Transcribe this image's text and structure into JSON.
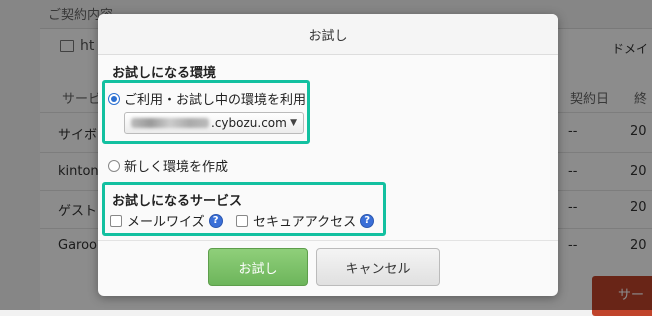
{
  "background": {
    "title": "ご契約内容",
    "link_text": "ht",
    "domain_label": "ドメイ",
    "columns": [
      "サービ",
      "契約日",
      "終"
    ],
    "rows": [
      {
        "name": "サイボ",
        "date": "--",
        "end": "20"
      },
      {
        "name": "kinton",
        "date": "--",
        "end": "20"
      },
      {
        "name": "ゲスト",
        "date": "--",
        "end": "20"
      },
      {
        "name": "Garoo",
        "date": "--",
        "end": "20"
      }
    ],
    "red_button": "サー"
  },
  "dialog": {
    "title": "お試し",
    "env_section_title": "お試しになる環境",
    "env_options": {
      "existing": {
        "label": "ご利用・お試し中の環境を利用",
        "selected": true
      },
      "new": {
        "label": "新しく環境を作成",
        "selected": false
      }
    },
    "env_select_value": ".cybozu.com",
    "service_section_title": "お試しになるサービス",
    "services": [
      {
        "label": "メールワイズ",
        "checked": false,
        "help_icon": "question-mark"
      },
      {
        "label": "セキュアアクセス",
        "checked": false,
        "help_icon": "question-mark"
      }
    ],
    "help_glyph": "?",
    "buttons": {
      "trial": "お試し",
      "cancel": "キャンセル"
    },
    "colors": {
      "highlight": "#12c0a0",
      "primary": "#6db55b",
      "radio": "#2a6fd1"
    }
  }
}
